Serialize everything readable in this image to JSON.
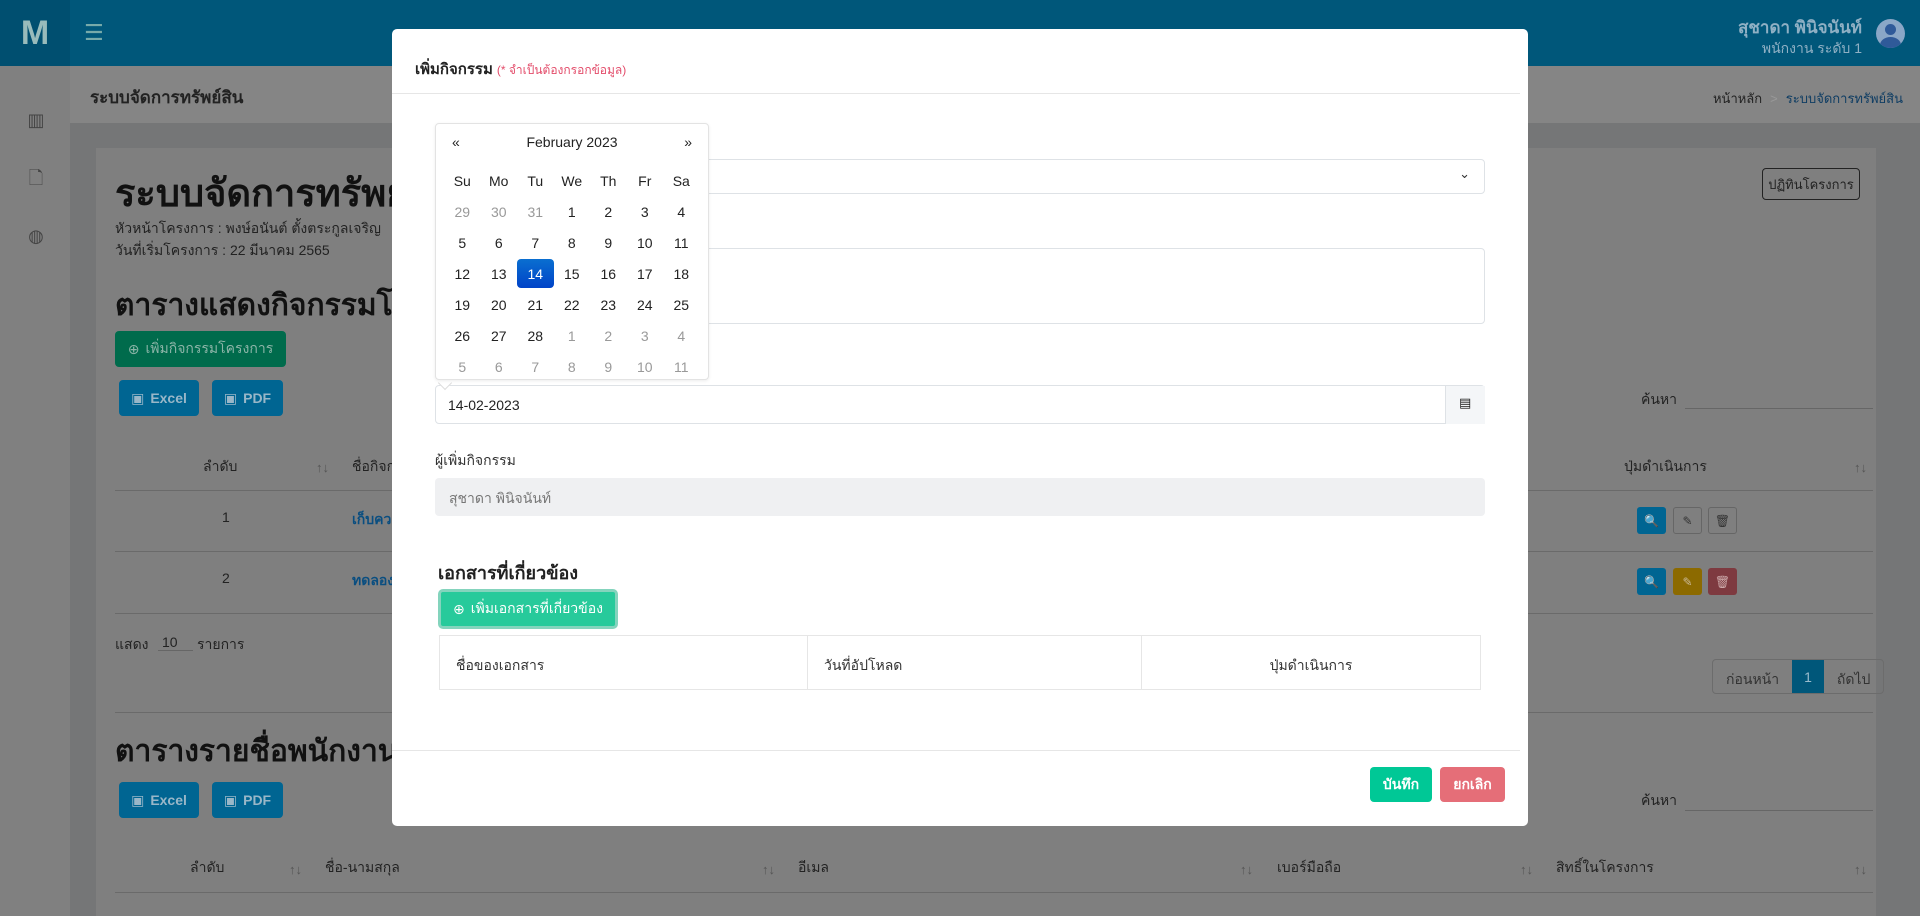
{
  "header": {
    "logo": "M",
    "user_name": "สุชาดา พินิจนันท์",
    "user_role": "พนักงาน ระดับ 1"
  },
  "breadcrumb": {
    "title": "ระบบจัดการทรัพย์สิน",
    "home": "หน้าหลัก",
    "current": "ระบบจัดการทรัพย์สิน"
  },
  "page": {
    "title": "ระบบจัดการทรัพย์สิน",
    "leader": "หัวหน้าโครงการ : พงษ์อนันต์ ตั้งตระกูลเจริญ",
    "start_date": "วันที่เริ่มโครงการ : 22 มีนาคม 2565",
    "calendar_button": "ปฏิทินโครงการ"
  },
  "activities": {
    "heading": "ตารางแสดงกิจกรรมโครงการ",
    "add_button": "เพิ่มกิจกรรมโครงการ",
    "excel": "Excel",
    "pdf": "PDF",
    "search_label": "ค้นหา",
    "columns": {
      "no": "ลำดับ",
      "name": "ชื่อกิจกรรม",
      "actions": "ปุ่มดำเนินการ"
    },
    "rows": [
      {
        "no": "1",
        "name": "เก็บควา"
      },
      {
        "no": "2",
        "name": "ทดลอง"
      }
    ],
    "show_label": "แสดง",
    "page_size": "10",
    "entries_label": "รายการ",
    "pagination": {
      "prev": "ก่อนหน้า",
      "page": "1",
      "next": "ถัดไป"
    }
  },
  "employees": {
    "heading": "ตารางรายชื่อพนักงาน",
    "excel": "Excel",
    "pdf": "PDF",
    "search_label": "ค้นหา",
    "columns": {
      "no": "ลำดับ",
      "name": "ชื่อ-นามสกุล",
      "email": "อีเมล",
      "phone": "เบอร์มือถือ",
      "role": "สิทธิ์ในโครงการ"
    }
  },
  "modal": {
    "title": "เพิ่มกิจกรรม",
    "required_note": "(* จำเป็นต้องกรอกข้อมูล)",
    "date_value": "14-02-2023",
    "creator_label": "ผู้เพิ่มกิจกรรม",
    "creator_value": "สุชาดา พินิจนันท์",
    "docs_heading": "เอกสารที่เกี่ยวข้อง",
    "add_doc_button": "เพิ่มเอกสารที่เกี่ยวข้อง",
    "doc_columns": {
      "name": "ชื่อของเอกสาร",
      "date": "วันที่อัปโหลด",
      "actions": "ปุ่มดำเนินการ"
    },
    "save": "บันทึก",
    "cancel": "ยกเลิก"
  },
  "datepicker": {
    "prev": "«",
    "next": "»",
    "month_label": "February 2023",
    "weekdays": [
      "Su",
      "Mo",
      "Tu",
      "We",
      "Th",
      "Fr",
      "Sa"
    ],
    "selected": "14",
    "weeks": [
      [
        "29",
        "30",
        "31",
        "1",
        "2",
        "3",
        "4"
      ],
      [
        "5",
        "6",
        "7",
        "8",
        "9",
        "10",
        "11"
      ],
      [
        "12",
        "13",
        "14",
        "15",
        "16",
        "17",
        "18"
      ],
      [
        "19",
        "20",
        "21",
        "22",
        "23",
        "24",
        "25"
      ],
      [
        "26",
        "27",
        "28",
        "1",
        "2",
        "3",
        "4"
      ],
      [
        "5",
        "6",
        "7",
        "8",
        "9",
        "10",
        "11"
      ]
    ]
  },
  "colors": {
    "header": "#00577a",
    "save": "#00c896",
    "cancel": "#e56e78",
    "selected_day": "#0b5ed7"
  }
}
